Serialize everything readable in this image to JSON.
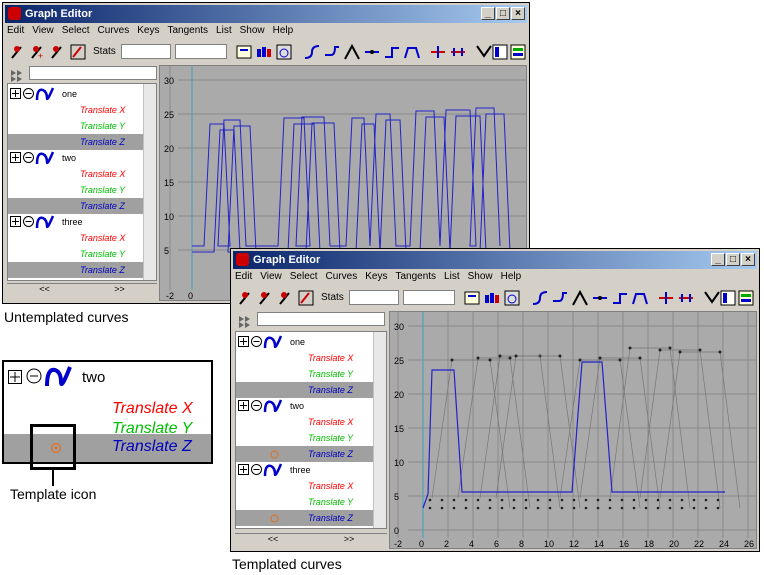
{
  "window": {
    "title": "Graph Editor",
    "menu": [
      "Edit",
      "View",
      "Select",
      "Curves",
      "Keys",
      "Tangents",
      "List",
      "Show",
      "Help"
    ],
    "stats_label": "Stats"
  },
  "outliner": {
    "objects": [
      {
        "name": "one",
        "channels": [
          "Translate X",
          "Translate Y",
          "Translate Z"
        ]
      },
      {
        "name": "two",
        "channels": [
          "Translate X",
          "Translate Y",
          "Translate Z"
        ]
      },
      {
        "name": "three",
        "channels": [
          "Translate X",
          "Translate Y",
          "Translate Z"
        ]
      }
    ],
    "nav_left": "<<",
    "nav_right": ">>"
  },
  "colors": {
    "x": "#ff0000",
    "y": "#00c000",
    "z": "#0000c0",
    "curve": "#2222cc",
    "template": "#777777"
  },
  "top_graph": {
    "y_ticks": [
      "30",
      "25",
      "20",
      "15",
      "10",
      "5"
    ],
    "x_ticks": [
      "-2",
      "0"
    ]
  },
  "bottom_graph": {
    "y_ticks": [
      "30",
      "25",
      "20",
      "15",
      "10",
      "5",
      "0"
    ],
    "x_ticks": [
      "-2",
      "0",
      "2",
      "4",
      "6",
      "8",
      "10",
      "12",
      "14",
      "16",
      "18",
      "20",
      "22",
      "24",
      "26"
    ]
  },
  "captions": {
    "top": "Untemplated curves",
    "bottom": "Templated curves",
    "icon": "Template icon"
  },
  "zoom": {
    "name": "two",
    "channels": [
      "Translate X",
      "Translate Y",
      "Translate Z"
    ]
  }
}
